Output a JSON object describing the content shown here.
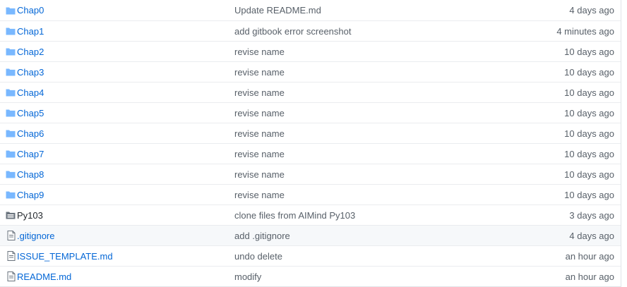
{
  "colors": {
    "folder": "#79b8ff",
    "folder_dark": "#6a737d",
    "link": "#0366d6",
    "muted": "#586069",
    "row_highlight": "#f6f8fa"
  },
  "files": [
    {
      "name": "Chap0",
      "type": "folder",
      "icon": "folder-icon",
      "message": "Update README.md",
      "age": "4 days ago"
    },
    {
      "name": "Chap1",
      "type": "folder",
      "icon": "folder-icon",
      "message": "add gitbook error screenshot",
      "age": "4 minutes ago"
    },
    {
      "name": "Chap2",
      "type": "folder",
      "icon": "folder-icon",
      "message": "revise name",
      "age": "10 days ago"
    },
    {
      "name": "Chap3",
      "type": "folder",
      "icon": "folder-icon",
      "message": "revise name",
      "age": "10 days ago"
    },
    {
      "name": "Chap4",
      "type": "folder",
      "icon": "folder-icon",
      "message": "revise name",
      "age": "10 days ago"
    },
    {
      "name": "Chap5",
      "type": "folder",
      "icon": "folder-icon",
      "message": "revise name",
      "age": "10 days ago"
    },
    {
      "name": "Chap6",
      "type": "folder",
      "icon": "folder-icon",
      "message": "revise name",
      "age": "10 days ago"
    },
    {
      "name": "Chap7",
      "type": "folder",
      "icon": "folder-icon",
      "message": "revise name",
      "age": "10 days ago"
    },
    {
      "name": "Chap8",
      "type": "folder",
      "icon": "folder-icon",
      "message": "revise name",
      "age": "10 days ago"
    },
    {
      "name": "Chap9",
      "type": "folder",
      "icon": "folder-icon",
      "message": "revise name",
      "age": "10 days ago"
    },
    {
      "name": "Py103",
      "type": "submodule",
      "icon": "submodule-folder-icon",
      "message": "clone files from AIMind Py103",
      "age": "3 days ago"
    },
    {
      "name": ".gitignore",
      "type": "file",
      "icon": "file-icon",
      "message": "add .gitignore",
      "age": "4 days ago",
      "highlight": true
    },
    {
      "name": "ISSUE_TEMPLATE.md",
      "type": "file",
      "icon": "file-icon",
      "message": "undo delete",
      "age": "an hour ago"
    },
    {
      "name": "README.md",
      "type": "file",
      "icon": "file-icon",
      "message": "modify",
      "age": "an hour ago"
    }
  ]
}
